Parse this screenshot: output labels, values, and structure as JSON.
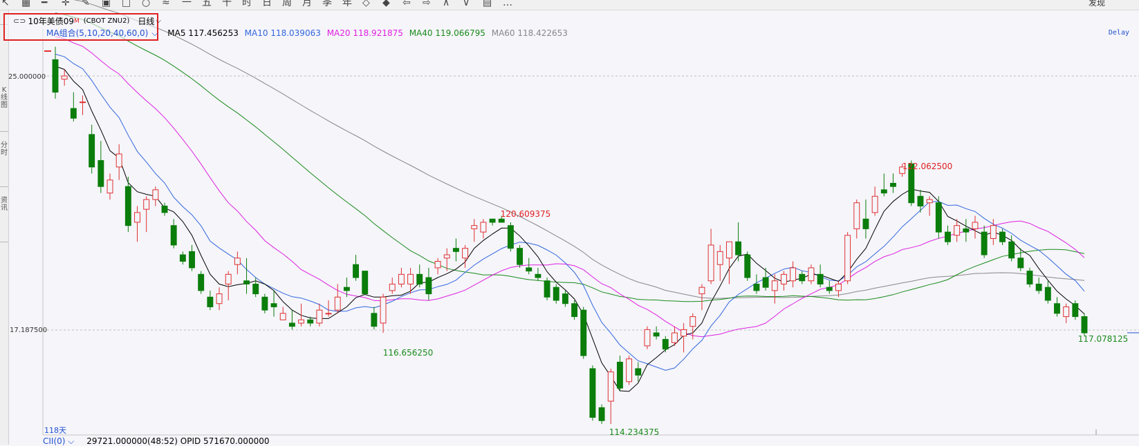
{
  "toolbar": {
    "icons": [
      "cursor-icon",
      "grid-icon",
      "line-icon",
      "cross-icon",
      "draw-icon",
      "table-icon",
      "window-icon",
      "circle-icon",
      "compare-icon",
      "minute-1-icon",
      "minute-5-icon",
      "minute-15-icon",
      "hour-icon",
      "day-icon",
      "week-icon",
      "month-icon",
      "season-icon",
      "year-icon",
      "scale-icon",
      "fullscreen-icon",
      "arrow-left-icon",
      "arrow-right-icon",
      "chevron-up-icon",
      "chevron-down-icon",
      "layout-icon",
      "more-icon"
    ],
    "glyphs": [
      "↖",
      "▦",
      "━",
      "✛",
      "✎",
      "▣",
      "□",
      "○",
      "≈",
      "一",
      "五",
      "十",
      "时",
      "日",
      "周",
      "月",
      "季",
      "年",
      "◇",
      "◆",
      "⇦",
      "⇨",
      "∧",
      "∨",
      "▤",
      "…"
    ],
    "discover_label": "发现"
  },
  "symbol": {
    "name": "10年美债09",
    "name_suffix": "M",
    "code": "(CBOT ZNU2)",
    "period": "日线"
  },
  "ma_legend": {
    "combo_label": "MA组合(5,10,20,40,60,0)",
    "items": [
      {
        "label": "MA5 117.456253",
        "color": "#000000"
      },
      {
        "label": "MA10 118.039063",
        "color": "#3366dd"
      },
      {
        "label": "MA20 118.921875",
        "color": "#e020e0"
      },
      {
        "label": "MA40 119.066795",
        "color": "#1a8a1a"
      },
      {
        "label": "MA60 118.422653",
        "color": "#888888"
      }
    ]
  },
  "status": {
    "delay": "Delay"
  },
  "axis": {
    "price_top_label": "25.000000",
    "price_bottom_label": "17.187500",
    "days_label": "118天"
  },
  "bottom": {
    "indicator_label": "CII(0)",
    "values_text": "29721.000000(48:52)  OPID 571670.000000"
  },
  "chart_data": {
    "type": "candlestick",
    "title": "10年美债09M (CBOT ZNU2) 日线",
    "y_ticks": [
      125.0,
      117.1875
    ],
    "annotations": {
      "high": {
        "label": "122.062500",
        "index": 39
      },
      "mid_high": {
        "label": "120.609375",
        "index": 20
      },
      "low": {
        "label": "114.234375",
        "index": 25
      },
      "first_low": {
        "label": "116.656250",
        "index": 16
      },
      "last": {
        "label": "117.078125",
        "index": 46
      }
    },
    "ma_colors": {
      "ma5": "#000000",
      "ma10": "#3366dd",
      "ma20": "#e020e0",
      "ma40": "#1a8a1a",
      "ma60": "#888888"
    },
    "up_color": "#e03030",
    "down_color": "#0a7d0a"
  }
}
